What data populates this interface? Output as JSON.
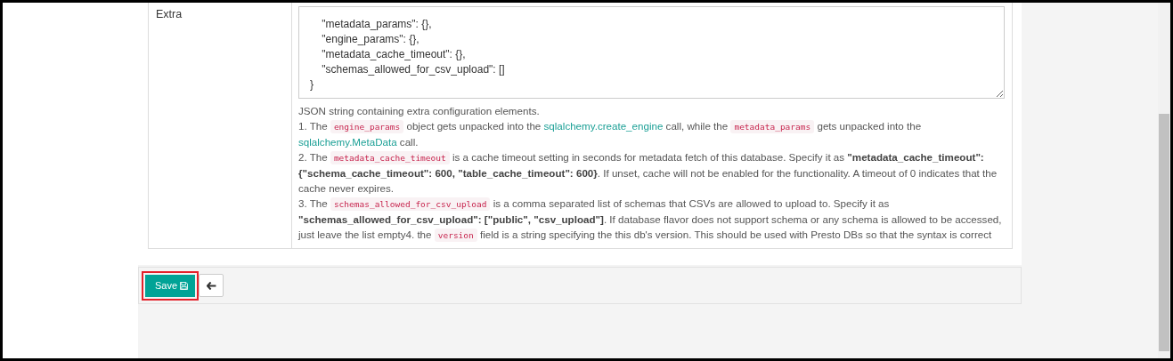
{
  "form_row": {
    "label": "Extra",
    "textarea": {
      "lines": [
        "    \"metadata_params\": {},",
        "    \"engine_params\": {},",
        "    \"metadata_cache_timeout\": {},",
        "    \"schemas_allowed_for_csv_upload\": []",
        "}"
      ]
    },
    "help": [
      [
        {
          "kind": "text",
          "text": "JSON string containing extra configuration elements."
        }
      ],
      [
        {
          "kind": "text",
          "text": "1. The "
        },
        {
          "kind": "code",
          "text": "engine_params"
        },
        {
          "kind": "text",
          "text": " object gets unpacked into the "
        },
        {
          "kind": "link",
          "text": "sqlalchemy.create_engine"
        },
        {
          "kind": "text",
          "text": " call, while the "
        },
        {
          "kind": "code",
          "text": "metadata_params"
        },
        {
          "kind": "text",
          "text": " gets unpacked into the "
        },
        {
          "kind": "link",
          "text": "sqlalchemy.MetaData"
        },
        {
          "kind": "text",
          "text": " call."
        }
      ],
      [
        {
          "kind": "text",
          "text": "2. The "
        },
        {
          "kind": "code",
          "text": "metadata_cache_timeout"
        },
        {
          "kind": "text",
          "text": " is a cache timeout setting in seconds for metadata fetch of this database. Specify it as "
        },
        {
          "kind": "bold",
          "text": "\"metadata_cache_timeout\": {\"schema_cache_timeout\": 600, \"table_cache_timeout\": 600}"
        },
        {
          "kind": "text",
          "text": ". If unset, cache will not be enabled for the functionality. A timeout of 0 indicates that the cache never expires."
        }
      ],
      [
        {
          "kind": "text",
          "text": "3. The "
        },
        {
          "kind": "code",
          "text": "schemas_allowed_for_csv_upload"
        },
        {
          "kind": "text",
          "text": " is a comma separated list of schemas that CSVs are allowed to upload to. Specify it as "
        },
        {
          "kind": "bold",
          "text": "\"schemas_allowed_for_csv_upload\": [\"public\", \"csv_upload\"]"
        },
        {
          "kind": "text",
          "text": ". If database flavor does not support schema or any schema is allowed to be accessed, just leave the list empty4. the "
        },
        {
          "kind": "code",
          "text": "version"
        },
        {
          "kind": "text",
          "text": " field is a string specifying the this db's version. This should be used with Presto DBs so that the syntax is correct"
        }
      ]
    ]
  },
  "actions": {
    "save": {
      "label": "Save",
      "highlighted": true
    }
  }
}
